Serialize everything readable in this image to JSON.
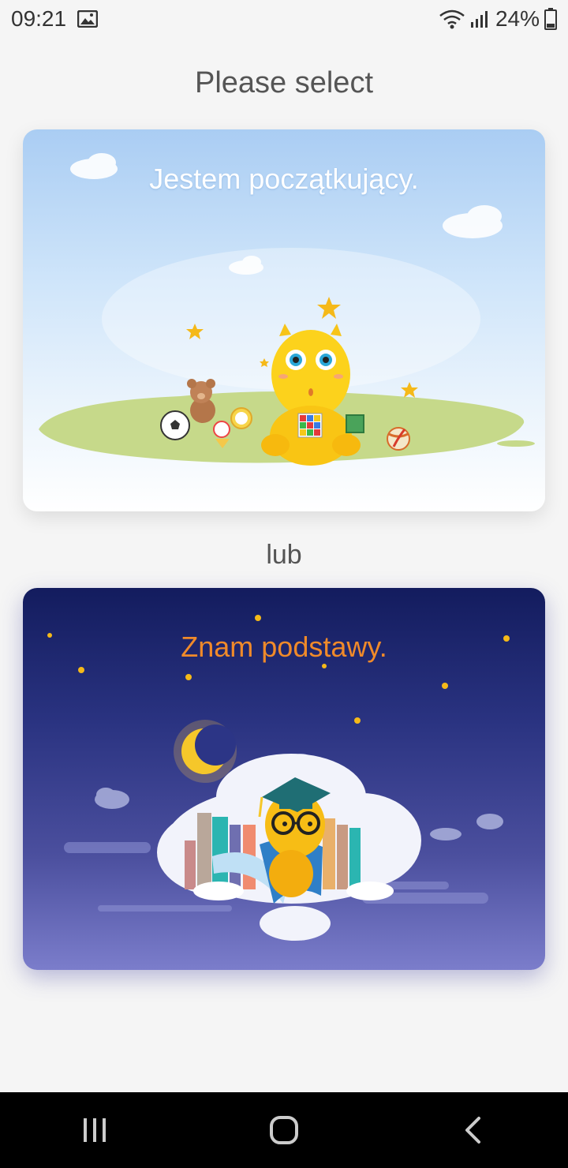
{
  "status_bar": {
    "time": "09:21",
    "battery": "24%",
    "icons": [
      "image-icon",
      "wifi-icon",
      "signal-icon",
      "battery-icon"
    ]
  },
  "page": {
    "title": "Please select",
    "separator": "lub"
  },
  "options": [
    {
      "label": "Jestem początkujący.",
      "theme": "day",
      "label_color": "#ffffff"
    },
    {
      "label": "Znam podstawy.",
      "theme": "night",
      "label_color": "#f08a2a"
    }
  ],
  "nav_bar": {
    "buttons": [
      "recent-apps-icon",
      "home-icon",
      "back-icon"
    ]
  },
  "colors": {
    "background": "#f5f5f5",
    "accent_orange": "#f08a2a",
    "night_top": "#131c5e",
    "night_bottom": "#7b7dcb",
    "day_top": "#aacdf3"
  }
}
